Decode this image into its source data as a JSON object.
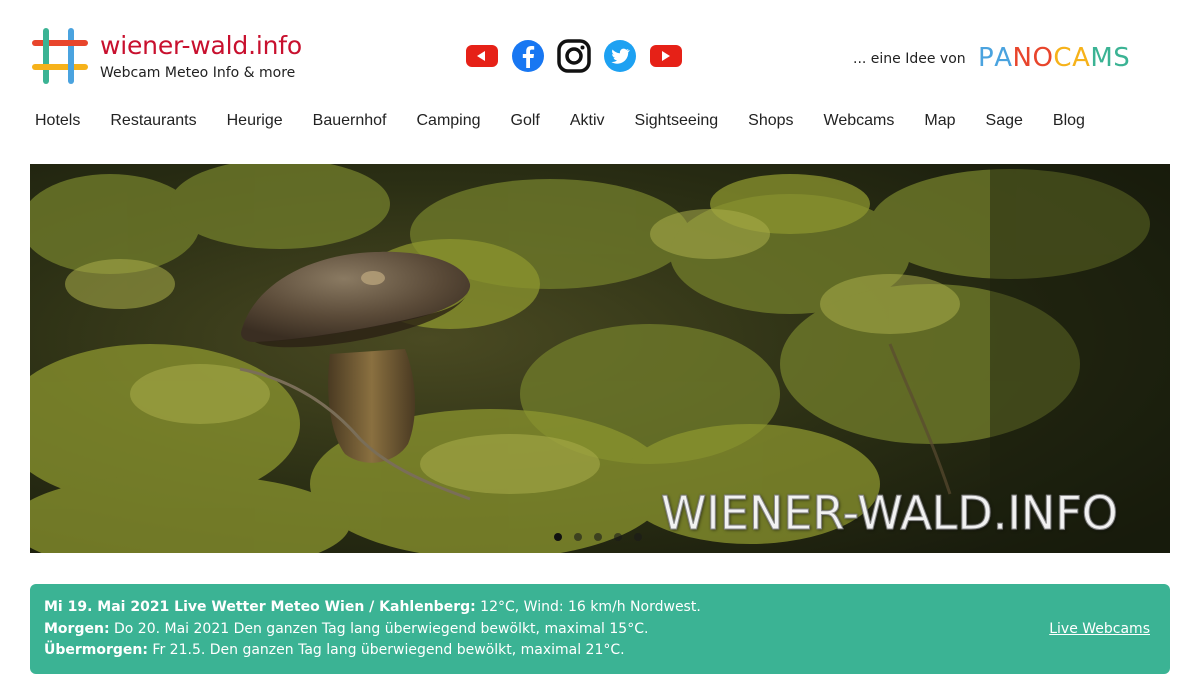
{
  "brand": {
    "title": "wiener-wald.info",
    "subtitle": "Webcam Meteo Info & more",
    "logo_icon": "hashtag-logo-icon",
    "title_color": "#c8102e"
  },
  "social": [
    {
      "name": "youtube-icon",
      "color": "#e62117"
    },
    {
      "name": "facebook-icon",
      "color": "#1877f2"
    },
    {
      "name": "instagram-icon",
      "color": "#111111"
    },
    {
      "name": "twitter-icon",
      "color": "#1da1f2"
    },
    {
      "name": "youtube-icon",
      "color": "#e62117"
    }
  ],
  "idea": {
    "text": "... eine Idee von",
    "brand_letters": [
      "P",
      "A",
      "N",
      "O",
      "C",
      "A",
      "M",
      "S"
    ],
    "brand_colors": [
      "#4aa3df",
      "#4aa3df",
      "#e8452c",
      "#e8452c",
      "#f6b21a",
      "#f6b21a",
      "#3bb394",
      "#3bb394"
    ]
  },
  "nav": [
    "Hotels",
    "Restaurants",
    "Heurige",
    "Bauernhof",
    "Camping",
    "Golf",
    "Aktiv",
    "Sightseeing",
    "Shops",
    "Webcams",
    "Map",
    "Sage",
    "Blog"
  ],
  "hero": {
    "overlay_text": "WIENER-WALD.INFO",
    "slide_count": 5,
    "active_slide": 0
  },
  "weather": {
    "today_label": "Mi 19. Mai 2021 Live Wetter Meteo Wien / Kahlenberg:",
    "today_value": " 12°C, Wind: 16 km/h Nordwest.",
    "tomorrow_label": "Morgen:",
    "tomorrow_value": " Do 20. Mai 2021 Den ganzen Tag lang überwiegend bewölkt, maximal 15°C.",
    "dayafter_label": "Übermorgen:",
    "dayafter_value": " Fr 21.5. Den ganzen Tag lang überwiegend bewölkt, maximal 21°C.",
    "link": "Live Webcams",
    "bg_color": "#3bb394"
  }
}
